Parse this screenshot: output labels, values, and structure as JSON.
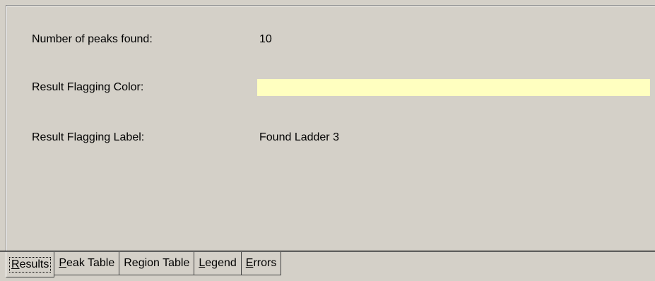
{
  "results": {
    "peaks_label": "Number of peaks found:",
    "peaks_value": "10",
    "color_label": "Result Flagging Color:",
    "color_value": "#FFFFC0",
    "flag_label": "Result Flagging Label:",
    "flag_value": "Found Ladder 3"
  },
  "tabs": [
    {
      "prefix": "",
      "accel": "R",
      "suffix": "esults",
      "active": true
    },
    {
      "prefix": "",
      "accel": "P",
      "suffix": "eak Table",
      "active": false
    },
    {
      "prefix": "Re",
      "accel": "g",
      "suffix": "ion Table",
      "active": false
    },
    {
      "prefix": "",
      "accel": "L",
      "suffix": "egend",
      "active": false
    },
    {
      "prefix": "",
      "accel": "E",
      "suffix": "rrors",
      "active": false
    }
  ]
}
